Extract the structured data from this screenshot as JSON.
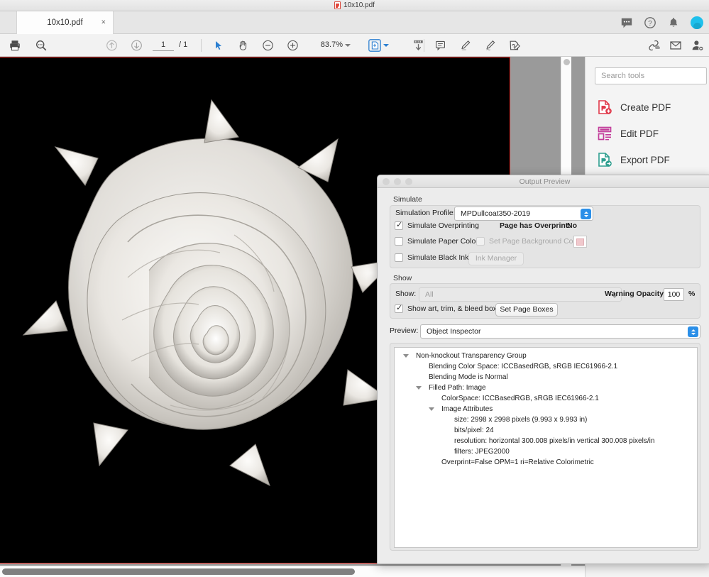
{
  "window": {
    "title": "10x10.pdf",
    "title_icon": "pdf-file-icon"
  },
  "tabs": [
    {
      "label": "10x10.pdf",
      "close": "×"
    }
  ],
  "tab_actions": [
    {
      "name": "comment-bubble-icon"
    },
    {
      "name": "help-circle-icon"
    },
    {
      "name": "bell-notification-icon"
    },
    {
      "name": "user-avatar"
    }
  ],
  "toolbar": {
    "print": "print-icon",
    "search": "search-magnifier-icon",
    "prev_page": "arrow-up-circle-icon",
    "next_page": "arrow-down-circle-icon",
    "page_current": "1",
    "page_separator": "/ 1",
    "select_tool": "cursor-arrow-icon",
    "hand_tool": "hand-pan-icon",
    "zoom_out": "minus-circle-icon",
    "zoom_in": "plus-circle-icon",
    "zoom_value": "83.7%",
    "zoom_caret": "chevron-down-icon",
    "page_thumbs": "page-manipulation-icon",
    "page_thumbs_caret": "chevron-down-icon",
    "fit_page": "fit-width-download-icon",
    "comment": "sticky-note-icon",
    "highlight": "highlighter-pen-icon",
    "sign": "signature-pen-icon",
    "fill_sign": "fill-and-sign-icon",
    "share_link": "link-cloud-icon",
    "email": "envelope-icon",
    "add_person": "add-user-icon"
  },
  "tools_panel": {
    "search_placeholder": "Search tools",
    "items": [
      {
        "label": "Create PDF",
        "icon": "create-pdf-icon",
        "color": "#e0394a"
      },
      {
        "label": "Edit PDF",
        "icon": "edit-pdf-icon",
        "color": "#c23c9a"
      },
      {
        "label": "Export PDF",
        "icon": "export-pdf-icon",
        "color": "#2e9e8f"
      }
    ]
  },
  "dialog": {
    "title": "Output Preview",
    "simulate": {
      "group_label": "Simulate",
      "profile_label": "Simulation Profile:",
      "profile_value": "MPDullcoat350-2019",
      "simulate_overprinting_label": "Simulate Overprinting",
      "simulate_overprinting_checked": true,
      "page_has_overprint_label": "Page has Overprint:",
      "page_has_overprint_value": "No",
      "simulate_paper_color_label": "Simulate Paper Color",
      "simulate_paper_color_checked": false,
      "set_page_background_color_label": "Set Page Background Color",
      "set_page_background_color_checked": false,
      "page_background_swatch_color": "#f0c8cc",
      "simulate_black_ink_label": "Simulate Black Ink",
      "simulate_black_ink_checked": false,
      "ink_manager_label": "Ink Manager"
    },
    "show": {
      "group_label": "Show",
      "show_label": "Show:",
      "show_value": "All",
      "warning_opacity_label": "Warning Opacity:",
      "warning_opacity_value": "100",
      "warning_opacity_unit": "%",
      "show_boxes_label": "Show art, trim, & bleed boxes",
      "show_boxes_checked": true,
      "set_page_boxes_label": "Set Page Boxes"
    },
    "preview": {
      "label": "Preview:",
      "value": "Object Inspector"
    },
    "inspector_rows": [
      {
        "text": "Non-knockout Transparency Group",
        "indent": 0,
        "disclosure": true
      },
      {
        "text": "Blending Color Space: ICCBasedRGB, sRGB IEC61966-2.1",
        "indent": 1,
        "disclosure": false
      },
      {
        "text": "Blending Mode is Normal",
        "indent": 1,
        "disclosure": false
      },
      {
        "text": "Filled Path: Image",
        "indent": 1,
        "disclosure": true
      },
      {
        "text": "ColorSpace: ICCBasedRGB, sRGB IEC61966-2.1",
        "indent": 2,
        "disclosure": false
      },
      {
        "text": "Image Attributes",
        "indent": 2,
        "disclosure": true
      },
      {
        "text": "size: 2998 x 2998 pixels (9.993 x 9.993 in)",
        "indent": 3,
        "disclosure": false
      },
      {
        "text": "bits/pixel: 24",
        "indent": 3,
        "disclosure": false
      },
      {
        "text": "resolution: horizontal 300.008 pixels/in vertical 300.008 pixels/in",
        "indent": 3,
        "disclosure": false
      },
      {
        "text": "filters: JPEG2000",
        "indent": 3,
        "disclosure": false
      },
      {
        "text": "Overprint=False OPM=1 ri=Relative Colorimetric",
        "indent": 2,
        "disclosure": false
      }
    ]
  },
  "document": {
    "page_background": "#000000",
    "page_box_outline": "#e3302b",
    "artwork_description": "white ceramic rose flower on black background"
  }
}
